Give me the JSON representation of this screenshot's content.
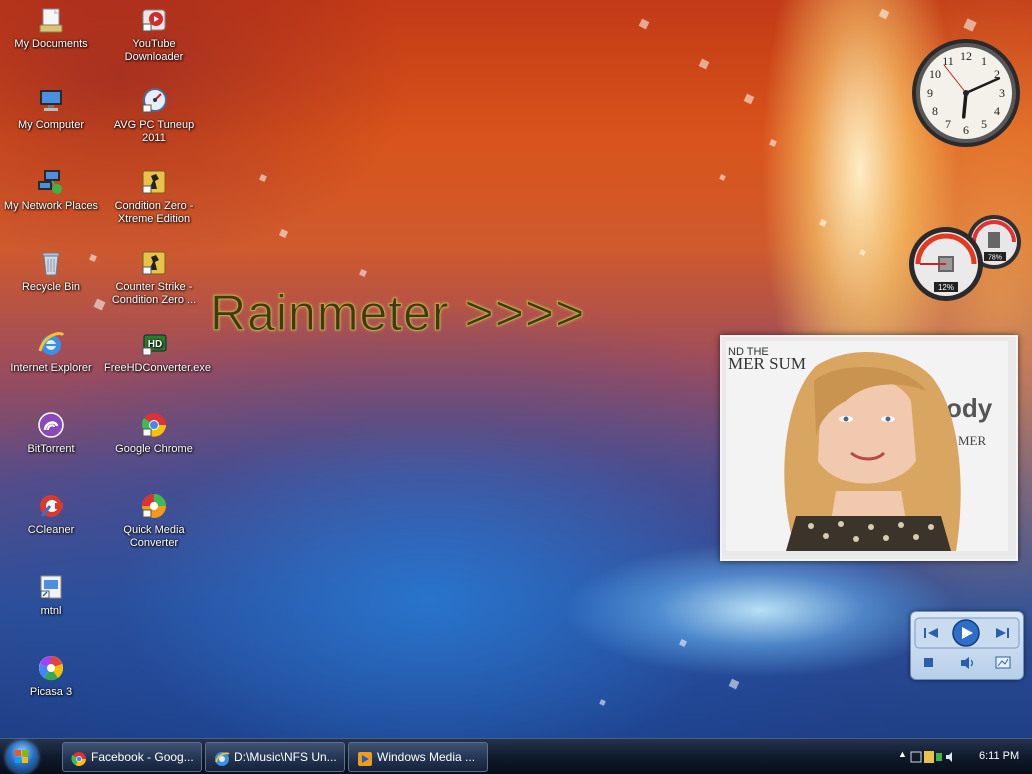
{
  "desktop": {
    "rainmeter_label": "Rainmeter >>>>",
    "icons_col1": [
      {
        "label": "My Documents",
        "icon": "documents-icon",
        "name": "my-documents"
      },
      {
        "label": "My Computer",
        "icon": "computer-icon",
        "name": "my-computer"
      },
      {
        "label": "My Network Places",
        "icon": "network-icon",
        "name": "my-network-places"
      },
      {
        "label": "Recycle Bin",
        "icon": "recycle-bin-icon",
        "name": "recycle-bin"
      },
      {
        "label": "Internet Explorer",
        "icon": "internet-explorer-icon",
        "name": "internet-explorer"
      },
      {
        "label": "BitTorrent",
        "icon": "bittorrent-icon",
        "name": "bittorrent"
      },
      {
        "label": "CCleaner",
        "icon": "ccleaner-icon",
        "name": "ccleaner"
      },
      {
        "label": "mtnl",
        "icon": "shortcut-icon",
        "name": "mtnl"
      },
      {
        "label": "Picasa 3",
        "icon": "picasa-icon",
        "name": "picasa-3"
      }
    ],
    "icons_col2": [
      {
        "label": "YouTube Downloader",
        "icon": "youtube-downloader-icon",
        "name": "youtube-downloader"
      },
      {
        "label": "AVG PC Tuneup 2011",
        "icon": "avg-tuneup-icon",
        "name": "avg-pc-tuneup"
      },
      {
        "label": "Condition Zero - Xtreme Edition",
        "icon": "counter-strike-icon",
        "name": "condition-zero-xtreme"
      },
      {
        "label": "Counter Strike - Condition Zero ...",
        "icon": "counter-strike-icon",
        "name": "counter-strike-condition-zero"
      },
      {
        "label": "FreeHDConverter.exe",
        "icon": "hd-converter-icon",
        "name": "freehdconverter"
      },
      {
        "label": "Google Chrome",
        "icon": "chrome-icon",
        "name": "google-chrome"
      },
      {
        "label": "Quick Media Converter",
        "icon": "media-converter-icon",
        "name": "quick-media-converter"
      }
    ]
  },
  "gadgets": {
    "clock": {
      "hour": 6,
      "minute": 11,
      "numbers": [
        "12",
        "1",
        "2",
        "3",
        "4",
        "5",
        "6",
        "7",
        "8",
        "9",
        "10",
        "11"
      ]
    },
    "meter": {
      "cpu_label": "12%",
      "memory_label": "78%"
    },
    "slideshow": {
      "photo_caption_top": "ND THE",
      "photo_caption_mid": "MER SUM",
      "photo_caption_right": "ody",
      "photo_caption_right2": "MER"
    }
  },
  "taskbar": {
    "tasks": [
      {
        "label": "Facebook - Goog...",
        "icon": "chrome-icon"
      },
      {
        "label": "D:\\Music\\NFS Un...",
        "icon": "explorer-icon"
      },
      {
        "label": "Windows Media ...",
        "icon": "media-player-icon"
      }
    ],
    "clock_text": "6:11 PM"
  },
  "colors": {
    "icon_text": "#ffffff",
    "taskbar_bg": "#0f1a2b",
    "rainmeter_fill": "#3e3a15"
  }
}
